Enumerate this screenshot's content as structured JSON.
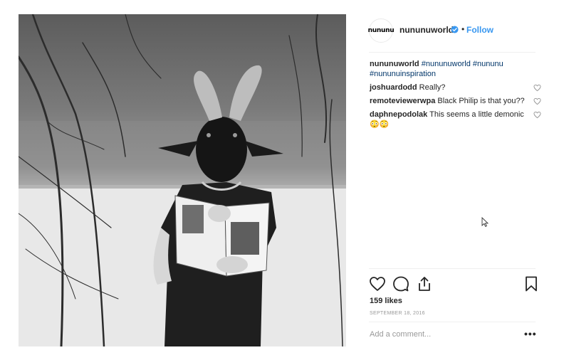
{
  "post": {
    "image_alt": "Black and white photo of a person wearing a goat mask holding an open book in a snowy forest",
    "header": {
      "avatar_text": "nununu",
      "username": "nununuworld",
      "verified_icon": "verified-badge-icon",
      "separator": "•",
      "follow_label": "Follow"
    },
    "caption": {
      "username": "nununuworld",
      "hashtags": [
        "#nununuworld",
        "#nununu",
        "#nununuinspiration"
      ]
    },
    "comments": [
      {
        "username": "joshuardodd",
        "text": "Really?"
      },
      {
        "username": "remoteviewerwpa",
        "text": "Black Philip is that you??"
      },
      {
        "username": "daphnepodolak",
        "text": "This seems a little demonic 😳😳"
      }
    ],
    "actions": {
      "icons": [
        "heart-icon",
        "comment-icon",
        "share-icon",
        "bookmark-icon"
      ]
    },
    "likes": "159 likes",
    "date": "SEPTEMBER 18, 2016",
    "add_comment_placeholder": "Add a comment...",
    "more_label": "•••"
  }
}
